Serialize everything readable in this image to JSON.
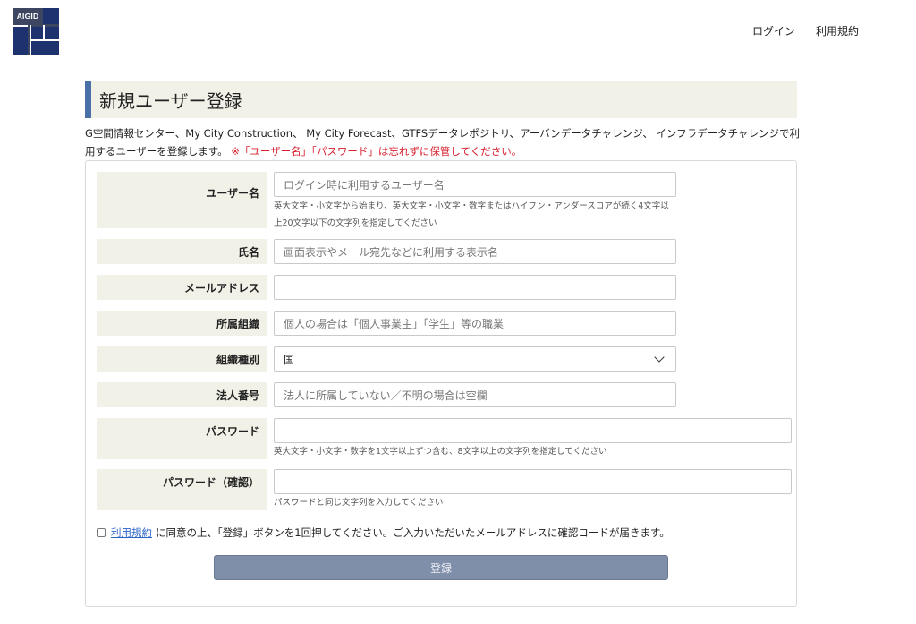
{
  "header": {
    "logo_text": "AIGID",
    "nav": [
      {
        "label": "ログイン"
      },
      {
        "label": "利用規約"
      }
    ]
  },
  "page": {
    "title": "新規ユーザー登録",
    "intro": "G空間情報センター、My City Construction、 My City Forecast、GTFSデータレポジトリ、アーバンデータチャレンジ、 インフラデータチャレンジで利用するユーザーを登録します。",
    "warning": "※「ユーザー名」「パスワード」は忘れずに保管してください。"
  },
  "form": {
    "username": {
      "label": "ユーザー名",
      "placeholder": "ログイン時に利用するユーザー名",
      "help": "英大文字・小文字から始まり、英大文字・小文字・数字またはハイフン・アンダースコアが続く4文字以上20文字以下の文字列を指定してください"
    },
    "fullname": {
      "label": "氏名",
      "placeholder": "画面表示やメール宛先などに利用する表示名"
    },
    "email": {
      "label": "メールアドレス",
      "placeholder": ""
    },
    "organization": {
      "label": "所属組織",
      "placeholder": "個人の場合は「個人事業主」「学生」等の職業"
    },
    "org_type": {
      "label": "組織種別",
      "value": "国"
    },
    "corp_number": {
      "label": "法人番号",
      "placeholder": "法人に所属していない／不明の場合は空欄"
    },
    "password": {
      "label": "パスワード",
      "placeholder": "",
      "help": "英大文字・小文字・数字を1文字以上ずつ含む、8文字以上の文字列を指定してください"
    },
    "password_confirm": {
      "label": "パスワード（確認）",
      "placeholder": "",
      "help": "パスワードと同じ文字列を入力してください"
    },
    "agree": {
      "link": "利用規約",
      "text": "に同意の上、「登録」ボタンを1回押してください。ご入力いただいたメールアドレスに確認コードが届きます。"
    },
    "submit_label": "登録"
  }
}
